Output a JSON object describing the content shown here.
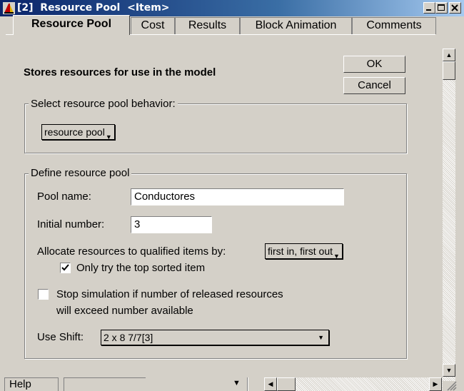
{
  "window": {
    "title": "[2]  Resource Pool  <Item>",
    "icon": "extend-app-icon",
    "controls": [
      "minimize",
      "maximize",
      "close"
    ]
  },
  "tabs": [
    {
      "label": "Resource Pool",
      "active": true
    },
    {
      "label": "Cost",
      "active": false
    },
    {
      "label": "Results",
      "active": false
    },
    {
      "label": "Block Animation",
      "active": false
    },
    {
      "label": "Comments",
      "active": false
    }
  ],
  "main": {
    "heading": "Stores resources for use in the model",
    "ok_label": "OK",
    "cancel_label": "Cancel",
    "behavior_group": {
      "legend": "Select resource pool behavior:",
      "selected": "resource pool"
    },
    "define_group": {
      "legend": "Define resource pool",
      "pool_name_label": "Pool name:",
      "pool_name_value": "Conductores",
      "initial_number_label": "Initial number:",
      "initial_number_value": "3",
      "allocate_label": "Allocate resources to qualified items by:",
      "allocate_selected": "first in, first out",
      "only_top_label": "Only try the top sorted item",
      "only_top_checked": true,
      "stop_sim_label_line1": "Stop simulation if number of released resources",
      "stop_sim_label_line2": "will exceed number available",
      "stop_sim_checked": false,
      "use_shift_label": "Use Shift:",
      "use_shift_selected": "2 x 8 7/7[3]"
    }
  },
  "footer": {
    "help_label": "Help"
  },
  "colors": {
    "title_start": "#0a246a",
    "title_end": "#a6caf0",
    "face": "#d4d0c8"
  }
}
